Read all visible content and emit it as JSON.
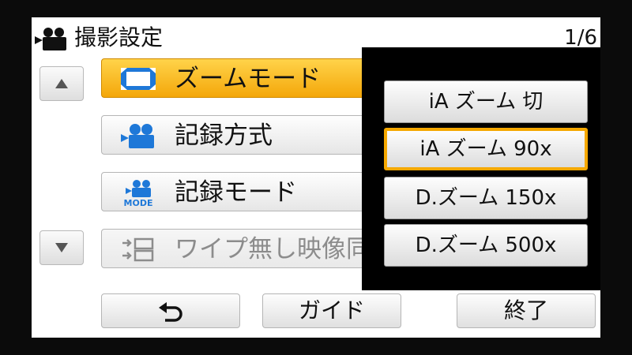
{
  "header": {
    "title": "撮影設定",
    "page_indicator": "1/6",
    "icon": "movie-camera-icon"
  },
  "scroll": {
    "up_icon": "triangle-up-icon",
    "down_icon": "triangle-down-icon"
  },
  "menu": {
    "items": [
      {
        "label": "ズームモード",
        "icon": "zoom-frame-icon",
        "state": "selected"
      },
      {
        "label": "記録方式",
        "icon": "movie-camera-icon",
        "state": "normal"
      },
      {
        "label": "記録モード",
        "icon": "movie-camera-mode-icon",
        "icon_text": "MODE",
        "state": "normal"
      },
      {
        "label": "ワイプ無し映像同時記",
        "icon": "wipe-recording-icon",
        "state": "disabled"
      }
    ]
  },
  "zoom_popup": {
    "options": [
      {
        "label": "iA ズーム 切",
        "selected": false
      },
      {
        "label": "iA ズーム 90x",
        "selected": true
      },
      {
        "label": "D.ズーム 150x",
        "selected": false
      },
      {
        "label": "D.ズーム 500x",
        "selected": false
      }
    ]
  },
  "footer": {
    "back_icon": "return-arrow-icon",
    "guide_label": "ガイド",
    "exit_label": "終了"
  },
  "colors": {
    "selected_fill": "#f7b21c",
    "selected_border": "#f5a800",
    "icon_blue": "#1e78d8",
    "disabled_text": "#8c8c8c",
    "popup_background": "#000000"
  }
}
